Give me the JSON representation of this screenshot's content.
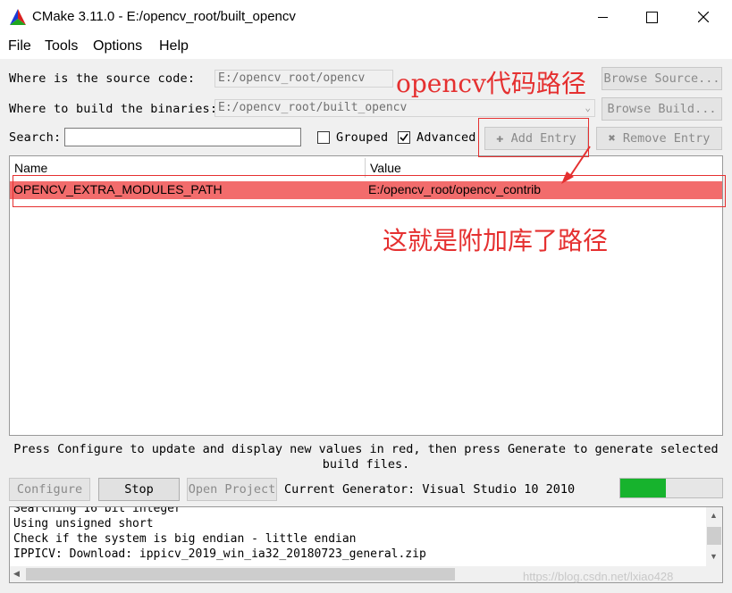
{
  "window": {
    "title": "CMake 3.11.0 - E:/opencv_root/built_opencv",
    "icon": "cmake-triangle-icon",
    "minimize": "—",
    "maximize": "☐",
    "close": "✕"
  },
  "menu": {
    "file": "File",
    "tools": "Tools",
    "options": "Options",
    "help": "Help"
  },
  "source": {
    "label": "Where is the source code:",
    "value": "E:/opencv_root/opencv",
    "browse": "Browse Source..."
  },
  "build": {
    "label": "Where to build the binaries:",
    "value": "E:/opencv_root/built_opencv",
    "browse": "Browse Build..."
  },
  "search": {
    "label": "Search:",
    "value": ""
  },
  "options": {
    "grouped": "Grouped",
    "grouped_checked": false,
    "advanced": "Advanced",
    "advanced_checked": true
  },
  "entries": {
    "add": "Add Entry",
    "remove": "Remove Entry"
  },
  "table": {
    "headers": {
      "name": "Name",
      "value": "Value"
    },
    "rows": [
      {
        "name": "OPENCV_EXTRA_MODULES_PATH",
        "value": "E:/opencv_root/opencv_contrib"
      }
    ]
  },
  "annotations": {
    "top": "opencv代码路径",
    "middle": "这就是附加库了路径",
    "color": "#e53030"
  },
  "hint": {
    "line1": "Press Configure to update and display new values in red, then press Generate to generate selected",
    "line2": "build files."
  },
  "actions": {
    "configure": "Configure",
    "stop": "Stop",
    "open_project": "Open Project"
  },
  "generator": {
    "text": "Current Generator: Visual Studio 10 2010"
  },
  "progress": {
    "fraction": 0.45,
    "color": "#17b32d"
  },
  "output": {
    "lines": [
      "Searching 16 bit integer",
      "Using unsigned short",
      "Check if the system is big endian - little endian",
      "IPPICV: Download: ippicv_2019_win_ia32_20180723_general.zip"
    ]
  },
  "watermark": "https://blog.csdn.net/lxiao428"
}
